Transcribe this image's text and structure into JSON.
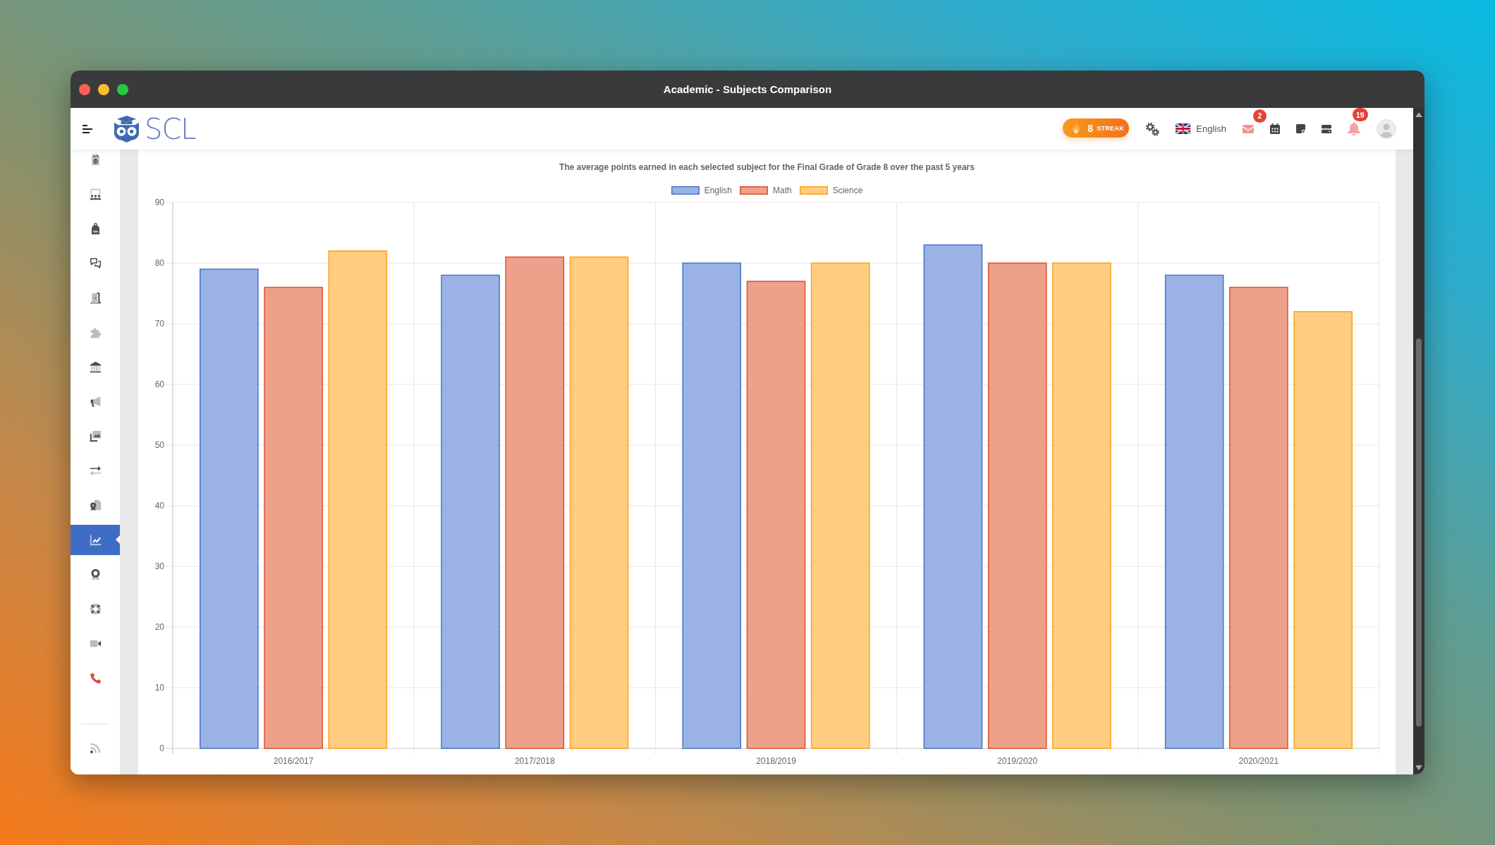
{
  "window": {
    "title": "Academic - Subjects Comparison"
  },
  "header": {
    "logo_text": "SCL",
    "streak": {
      "count": "8",
      "label": "STREAK"
    },
    "language": "English",
    "mail_badge": "2",
    "notification_badge": "19"
  },
  "sidebar": {
    "items": [
      {
        "kind": "invoice",
        "selected": false
      },
      {
        "kind": "classroom",
        "selected": false
      },
      {
        "kind": "backpack",
        "selected": false
      },
      {
        "kind": "chat",
        "selected": false
      },
      {
        "kind": "door",
        "selected": false
      },
      {
        "kind": "puzzle",
        "selected": false
      },
      {
        "kind": "bank",
        "selected": false
      },
      {
        "kind": "megaphone",
        "selected": false
      },
      {
        "kind": "gallery",
        "selected": false
      },
      {
        "kind": "transfer",
        "selected": false
      },
      {
        "kind": "certificate",
        "selected": false
      },
      {
        "kind": "chart",
        "selected": true
      },
      {
        "kind": "award",
        "selected": false
      },
      {
        "kind": "lifebuoy",
        "selected": false
      },
      {
        "kind": "video",
        "selected": false
      },
      {
        "kind": "phone",
        "selected": false
      }
    ],
    "bottom_items": [
      {
        "kind": "rss",
        "selected": false
      }
    ]
  },
  "chart": {
    "chart_data": {
      "type": "bar",
      "title": "The average points earned in each selected subject for the Final Grade of Grade 8 over the past 5 years",
      "categories": [
        "2016/2017",
        "2017/2018",
        "2018/2019",
        "2019/2020",
        "2020/2021"
      ],
      "series": [
        {
          "name": "English",
          "color": "#9ab3e4",
          "values": [
            79,
            78,
            80,
            83,
            78
          ]
        },
        {
          "name": "Math",
          "color": "#eda08a",
          "values": [
            76,
            81,
            77,
            80,
            76
          ]
        },
        {
          "name": "Science",
          "color": "#ffcc80",
          "values": [
            82,
            81,
            80,
            80,
            72
          ]
        }
      ],
      "ylim": [
        0,
        90
      ],
      "yticks": [
        0,
        10,
        20,
        30,
        40,
        50,
        60,
        70,
        80,
        90
      ],
      "grid": true,
      "legend": "top"
    }
  }
}
